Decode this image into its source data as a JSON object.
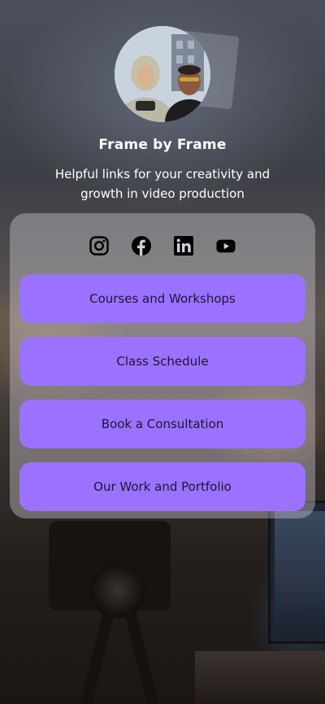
{
  "profile": {
    "title": "Frame by Frame",
    "tagline": "Helpful links for your creativity and growth in video production",
    "avatar_description": "avatar-photo"
  },
  "social": [
    {
      "name": "instagram-icon",
      "label": "Instagram"
    },
    {
      "name": "facebook-icon",
      "label": "Facebook"
    },
    {
      "name": "linkedin-icon",
      "label": "LinkedIn"
    },
    {
      "name": "youtube-icon",
      "label": "YouTube"
    }
  ],
  "links": [
    {
      "label": "Courses and Workshops"
    },
    {
      "label": "Class Schedule"
    },
    {
      "label": "Book a Consultation"
    },
    {
      "label": "Our Work and Portfolio"
    }
  ],
  "colors": {
    "button_bg": "#9b72ff",
    "button_text": "#1c1630",
    "card_bg": "rgba(210,208,214,0.40)",
    "heading_text": "#ffffff"
  }
}
